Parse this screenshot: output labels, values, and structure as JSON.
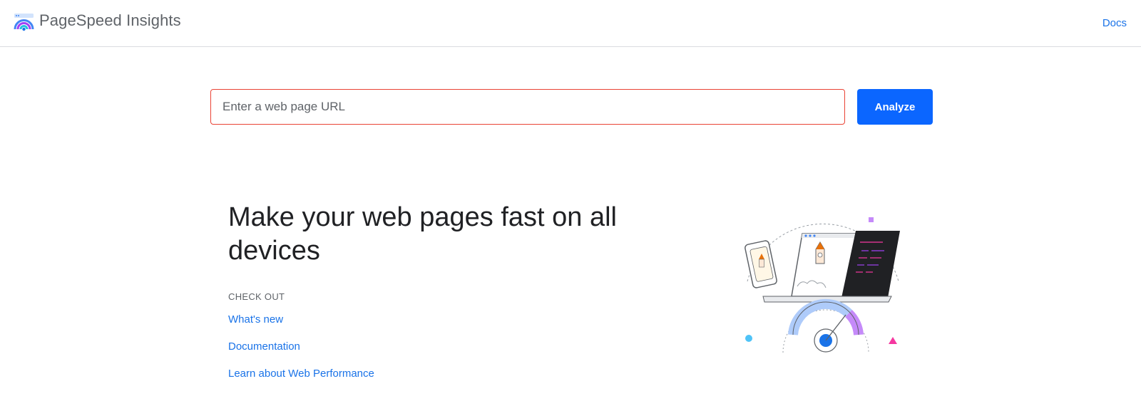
{
  "header": {
    "app_title": "PageSpeed Insights",
    "docs_label": "Docs"
  },
  "search": {
    "placeholder": "Enter a web page URL",
    "value": "",
    "button_label": "Analyze"
  },
  "hero": {
    "headline": "Make your web pages fast on all devices",
    "section_label": "CHECK OUT",
    "links": [
      {
        "label": "What's new"
      },
      {
        "label": "Documentation"
      },
      {
        "label": "Learn about Web Performance"
      }
    ]
  },
  "colors": {
    "accent": "#0b66ff",
    "link": "#1a73e8",
    "error_border": "#ea4335"
  },
  "icons": {
    "logo": "pagespeed-logo-icon",
    "illustration": "speed-devices-illustration"
  }
}
